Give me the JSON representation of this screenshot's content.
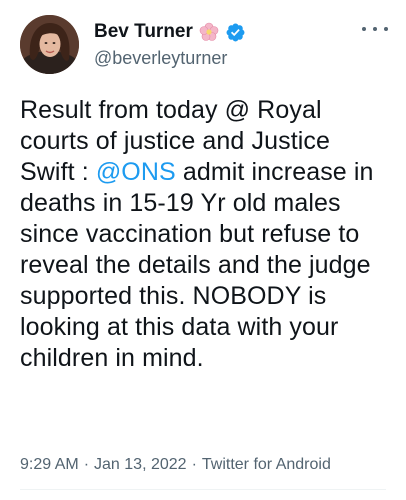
{
  "author": {
    "display_name": "Bev Turner",
    "handle": "@beverleyturner",
    "emoji": "🌸",
    "verified": true
  },
  "tweet": {
    "text_part1": "Result from today @ Royal courts of justice and Justice Swift : ",
    "mention": "@ONS",
    "text_part2": " admit increase in deaths in 15-19 Yr old males since vaccination but refuse to reveal the details and the judge supported this. NOBODY is looking at this data with your children in mind."
  },
  "meta": {
    "time": "9:29 AM",
    "separator": "·",
    "date": "Jan 13, 2022",
    "source": "Twitter for Android"
  },
  "icons": {
    "verified": "verified-badge-icon",
    "more": "more-options-icon"
  },
  "colors": {
    "accent": "#1d9bf0",
    "text": "#0f1419",
    "secondary": "#536471"
  }
}
